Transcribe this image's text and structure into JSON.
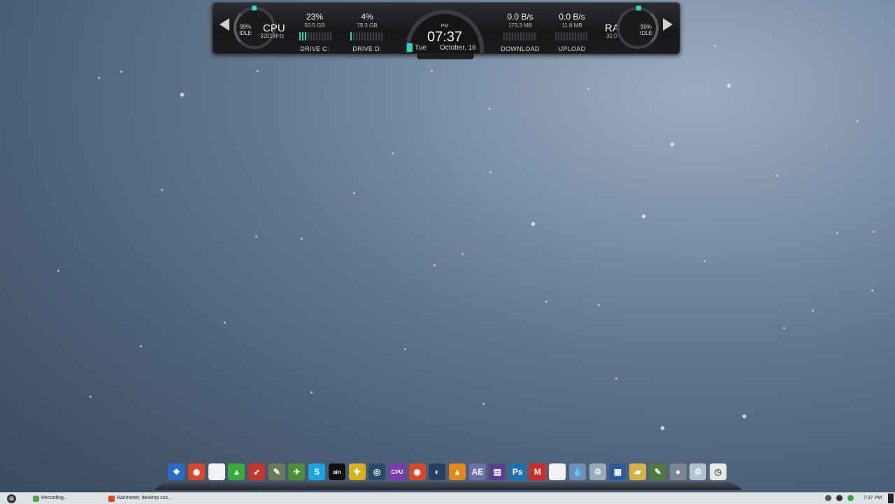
{
  "rainmeter": {
    "cpu": {
      "label": "CPU",
      "freq": "3201MHz",
      "idle_pct": "99%",
      "idle_label": "IDLE"
    },
    "drive_c": {
      "pct": "23%",
      "size": "50.5 GB",
      "label": "DRIVE C:",
      "fill": 0.23
    },
    "drive_d": {
      "pct": "4%",
      "size": "79.3 GB",
      "label": "DRIVE D:",
      "fill": 0.04
    },
    "clock": {
      "ampm": "PM",
      "time": "07:37",
      "day": "Tue",
      "date": "October, 16"
    },
    "download": {
      "rate": "0.0 B/s",
      "total": "173.3 MB",
      "label": "DOWNLOAD"
    },
    "upload": {
      "rate": "0.0 B/s",
      "total": "11.8 MB",
      "label": "UPLOAD"
    },
    "ram": {
      "label": "RAM",
      "size": "32.0 GB",
      "idle_pct": "90%",
      "idle_label": "IDLE"
    },
    "accent_color": "#37d0c8"
  },
  "dock": {
    "items": [
      {
        "name": "windows-start-icon",
        "glyph": "❖",
        "bg": "#2a6bc4"
      },
      {
        "name": "chrome-icon",
        "glyph": "◉",
        "bg": "#d9482b"
      },
      {
        "name": "blank-file-icon",
        "glyph": "",
        "bg": "#f2f2f2"
      },
      {
        "name": "green-drop-icon",
        "glyph": "▲",
        "bg": "#3aa83a"
      },
      {
        "name": "red-bird-icon",
        "glyph": "➶",
        "bg": "#c2362d"
      },
      {
        "name": "notepad-icon",
        "glyph": "✎",
        "bg": "#6b7a5a"
      },
      {
        "name": "network-globe-icon",
        "glyph": "✈",
        "bg": "#4b8e3a"
      },
      {
        "name": "skype-icon",
        "glyph": "S",
        "bg": "#1fa3e0"
      },
      {
        "name": "rainmeter-icon",
        "glyph": "ain",
        "bg": "#111111"
      },
      {
        "name": "puzzle-icon",
        "glyph": "✚",
        "bg": "#d8b21c"
      },
      {
        "name": "media-player-icon",
        "glyph": "◎",
        "bg": "#2a4a6a"
      },
      {
        "name": "cpu-z-icon",
        "glyph": "CPU",
        "bg": "#7a3db0"
      },
      {
        "name": "chrome-icon-2",
        "glyph": "◉",
        "bg": "#d9482b"
      },
      {
        "name": "cinema4d-icon",
        "glyph": "◐",
        "bg": "#2b3d63"
      },
      {
        "name": "vlc-icon",
        "glyph": "▲",
        "bg": "#e08a1a"
      },
      {
        "name": "after-effects-icon",
        "glyph": "AE",
        "bg": "#6c6fa8"
      },
      {
        "name": "premiere-icon",
        "glyph": "▤",
        "bg": "#5a3f8e"
      },
      {
        "name": "photoshop-icon",
        "glyph": "Ps",
        "bg": "#1f6fb3"
      },
      {
        "name": "malwarebytes-icon",
        "glyph": "M",
        "bg": "#c9302c"
      },
      {
        "name": "document-icon",
        "glyph": "",
        "bg": "#f2f2f2"
      },
      {
        "name": "water-drop-icon",
        "glyph": "💧",
        "bg": "#6f8fb8"
      },
      {
        "name": "recycle-bin-icon",
        "glyph": "♲",
        "bg": "#9aaab8"
      },
      {
        "name": "computer-icon",
        "glyph": "▣",
        "bg": "#2e5a9a"
      },
      {
        "name": "folder-icon",
        "glyph": "▰",
        "bg": "#d4b24a"
      },
      {
        "name": "image-editor-icon",
        "glyph": "✎",
        "bg": "#4d7a3d"
      },
      {
        "name": "disc-icon",
        "glyph": "●",
        "bg": "#7d8590"
      },
      {
        "name": "trash-icon",
        "glyph": "♲",
        "bg": "#b5c2cc"
      },
      {
        "name": "clock-icon",
        "glyph": "◷",
        "bg": "#e8e8e8"
      }
    ]
  },
  "taskbar": {
    "start_glyph": "⊗",
    "tasks": [
      {
        "label": "Recording...",
        "icon_color": "#5aa04a"
      },
      {
        "label": "Rainmeter, desktop cus...",
        "icon_color": "#d9482b"
      }
    ],
    "clock": "7:37 PM"
  }
}
